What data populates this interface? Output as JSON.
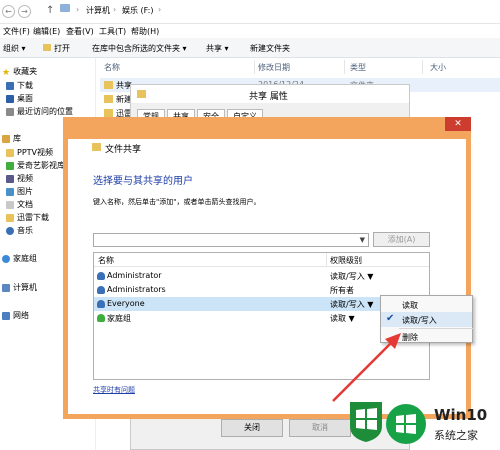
{
  "explorer": {
    "nav_back": "←",
    "nav_forward": "→",
    "nav_up": "↑",
    "breadcrumb": [
      "计算机",
      "娱乐 (F:)"
    ],
    "menu": [
      "文件(F)",
      "编辑(E)",
      "查看(V)",
      "工具(T)",
      "帮助(H)"
    ],
    "toolbar": [
      "组织 ▾",
      "打开",
      "在库中包含所选的文件夹 ▾",
      "共享 ▾",
      "新建文件夹"
    ],
    "nav_pane": [
      {
        "label": "收藏夹",
        "icon": "star-icon"
      },
      {
        "label": "下载",
        "icon": "folder-icon"
      },
      {
        "label": "桌面",
        "icon": "desktop-icon"
      },
      {
        "label": "最近访问的位置",
        "icon": "recent-icon"
      },
      {
        "label": "库",
        "icon": "library-icon"
      },
      {
        "label": "PPTV视频",
        "icon": "folder-icon"
      },
      {
        "label": "爱奇艺影视库",
        "icon": "folder-icon"
      },
      {
        "label": "视频",
        "icon": "video-icon"
      },
      {
        "label": "图片",
        "icon": "picture-icon"
      },
      {
        "label": "文档",
        "icon": "document-icon"
      },
      {
        "label": "迅雷下载",
        "icon": "folder-icon"
      },
      {
        "label": "音乐",
        "icon": "music-icon"
      },
      {
        "label": "家庭组",
        "icon": "homegroup-icon"
      },
      {
        "label": "计算机",
        "icon": "computer-icon"
      },
      {
        "label": "网络",
        "icon": "network-icon"
      }
    ],
    "columns": [
      "名称",
      "修改日期",
      "类型",
      "大小"
    ],
    "rows": [
      {
        "name": "共享",
        "date": "2016/12/24 ...",
        "type": "文件夹"
      },
      {
        "name": "新建",
        "date": "",
        "type": ""
      },
      {
        "name": "迅雷",
        "date": "",
        "type": ""
      }
    ]
  },
  "properties": {
    "title": "共享 属性",
    "tabs": [
      "常规",
      "共享",
      "安全",
      "自定义"
    ]
  },
  "wizard": {
    "title": "文件共享",
    "heading": "选择要与其共享的用户",
    "instruction": "键入名称，然后单击\"添加\"，或者单击箭头查找用户。",
    "add_button": "添加(A)",
    "col_name": "名称",
    "col_permission": "权限级别",
    "users": [
      {
        "name": "Administrator",
        "permission": "读取/写入 ▼"
      },
      {
        "name": "Administrators",
        "permission": "所有者"
      },
      {
        "name": "Everyone",
        "permission": "读取/写入 ▼"
      },
      {
        "name": "家庭组",
        "permission": "读取 ▼"
      }
    ],
    "help_link": "共享时有问题"
  },
  "permission_menu": {
    "items": [
      "读取",
      "读取/写入",
      "删除"
    ],
    "checked": "读取/写入",
    "check_glyph": "✔"
  },
  "props_buttons": [
    "关闭",
    "取消"
  ],
  "watermark": {
    "brand": "Win10",
    "subtitle": "系统之家"
  },
  "colors": {
    "wizard_frame": "#f3a45d",
    "heading": "#1e3ea8",
    "selection": "#cce4f7",
    "close": "#cc3d30",
    "arrow": "#e53935"
  }
}
